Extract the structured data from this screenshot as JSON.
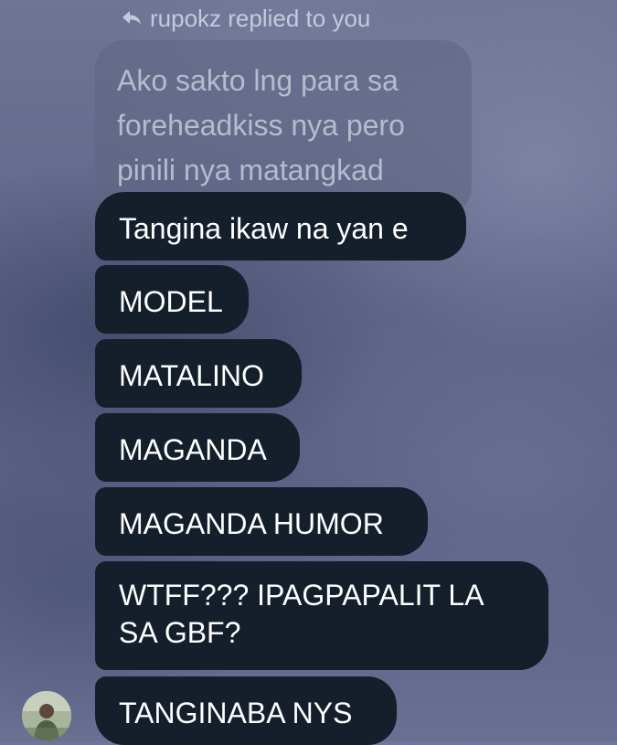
{
  "reply_header": {
    "icon": "reply-arrow-icon",
    "text": "rupokz replied to you"
  },
  "quoted_message": {
    "lines": [
      "Ako sakto lng para sa",
      "foreheadkiss nya pero",
      "pinili nya matangkad"
    ]
  },
  "messages": [
    "Tangina ikaw na yan e",
    "MODEL",
    "MATALINO",
    "MAGANDA",
    "MAGANDA HUMOR",
    "WTFF??? IPAGPAPALIT LA SA GBF?",
    "TANGINABA NYS"
  ],
  "colors": {
    "bubble_background": "#141f2b",
    "bubble_text": "#ffffff",
    "quoted_bubble_background": "#5f6784",
    "quoted_text": "#d6dae8"
  }
}
